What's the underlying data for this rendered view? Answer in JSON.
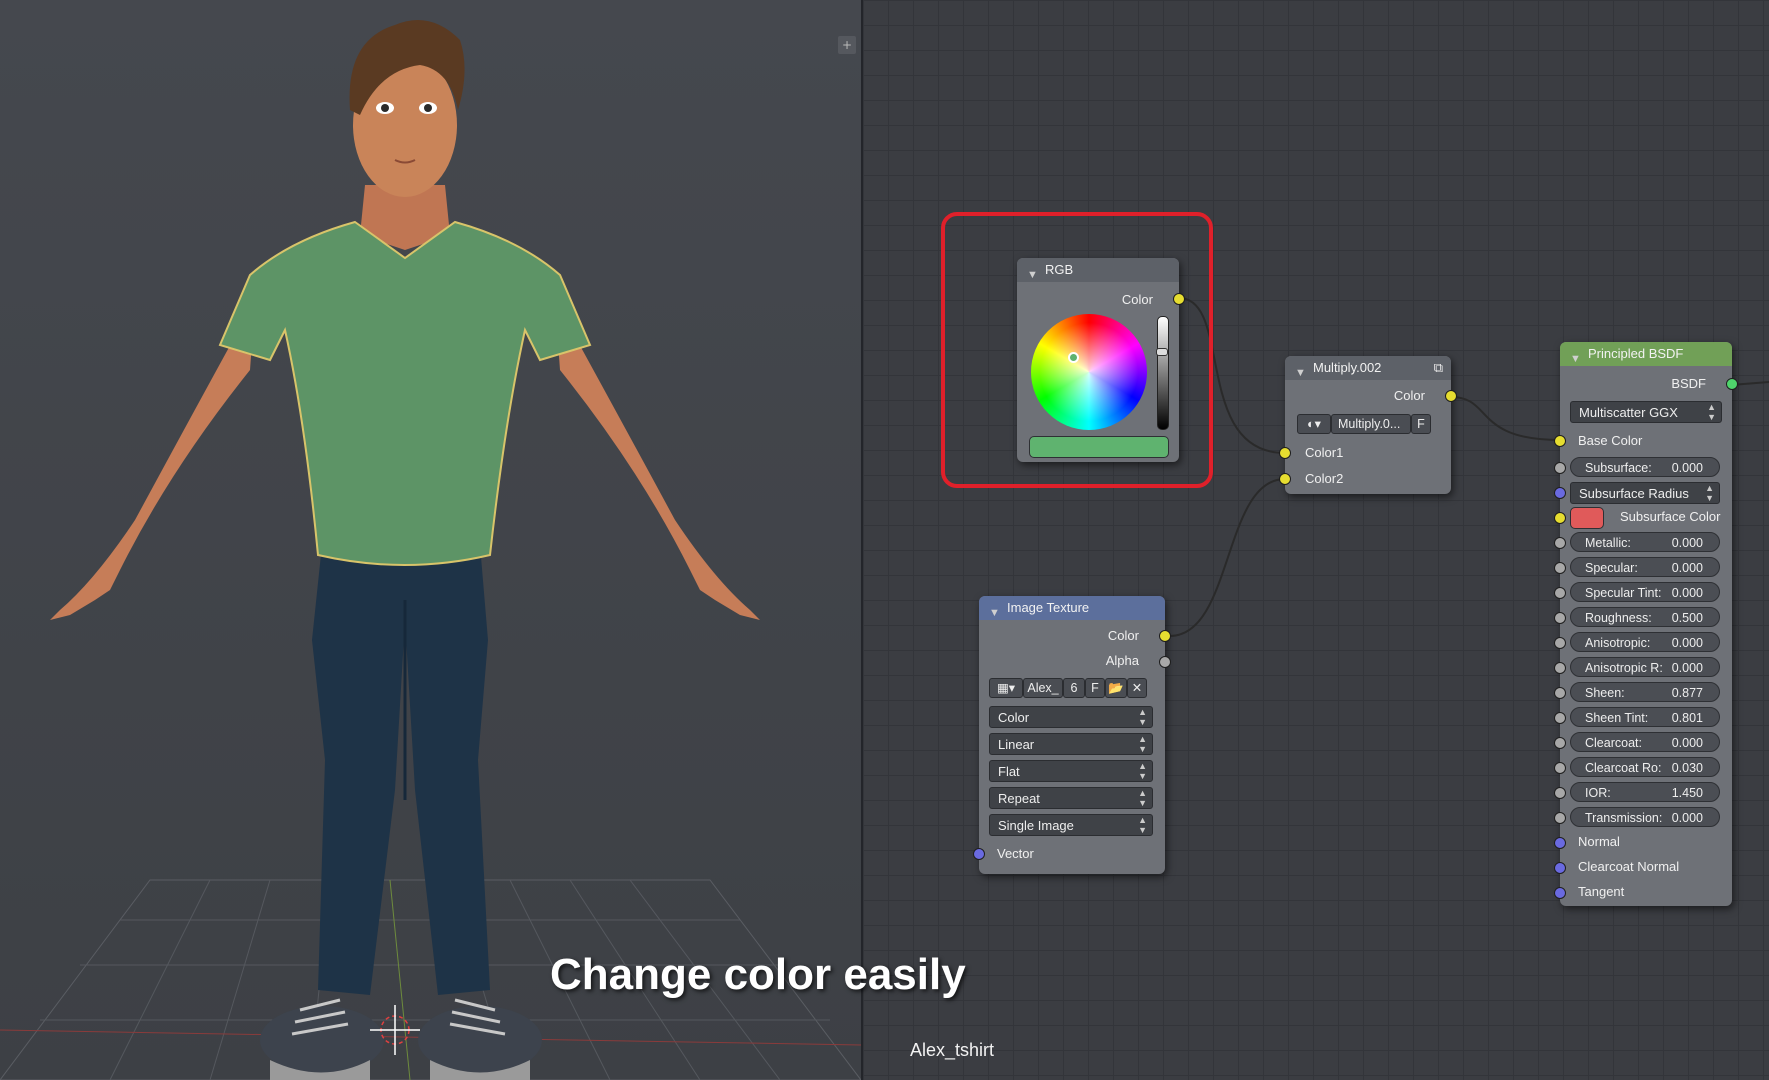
{
  "caption": "Change color easily",
  "material_name": "Alex_tshirt",
  "viewport": {
    "corner_buttons": [
      "+",
      "+"
    ]
  },
  "colors": {
    "rgb_swatch": "#5fb36f",
    "subsurface_color": "#e05a5a",
    "image_texture_header": "#5c6f9c",
    "shader_header": "#71a057",
    "converter_header": "#5d6168",
    "highlight": "#e0202a"
  },
  "nodes": {
    "rgb": {
      "title": "RGB",
      "output": "Color"
    },
    "multiply": {
      "title": "Multiply.002",
      "output": "Color",
      "datablock": "Multiply.0...",
      "fake_user": "F",
      "inputs": [
        "Color1",
        "Color2"
      ]
    },
    "image_texture": {
      "title": "Image Texture",
      "outputs": [
        "Color",
        "Alpha"
      ],
      "image_name": "Alex_",
      "users": "6",
      "fake_user": "F",
      "dropdowns": [
        "Color",
        "Linear",
        "Flat",
        "Repeat",
        "Single Image"
      ],
      "input": "Vector"
    },
    "principled": {
      "title": "Principled BSDF",
      "output": "BSDF",
      "distribution": "Multiscatter GGX",
      "base_color_label": "Base Color",
      "subsurface_radius": "Subsurface Radius",
      "subsurface_color_label": "Subsurface Color",
      "fields": [
        {
          "label": "Subsurface:",
          "value": "0.000"
        },
        {
          "label": "Metallic:",
          "value": "0.000"
        },
        {
          "label": "Specular:",
          "value": "0.000"
        },
        {
          "label": "Specular Tint:",
          "value": "0.000"
        },
        {
          "label": "Roughness:",
          "value": "0.500"
        },
        {
          "label": "Anisotropic:",
          "value": "0.000"
        },
        {
          "label": "Anisotropic R:",
          "value": "0.000"
        },
        {
          "label": "Sheen:",
          "value": "0.877"
        },
        {
          "label": "Sheen Tint:",
          "value": "0.801"
        },
        {
          "label": "Clearcoat:",
          "value": "0.000"
        },
        {
          "label": "Clearcoat Ro:",
          "value": "0.030"
        },
        {
          "label": "IOR:",
          "value": "1.450"
        },
        {
          "label": "Transmission:",
          "value": "0.000"
        }
      ],
      "vector_inputs": [
        "Normal",
        "Clearcoat Normal",
        "Tangent"
      ]
    }
  }
}
